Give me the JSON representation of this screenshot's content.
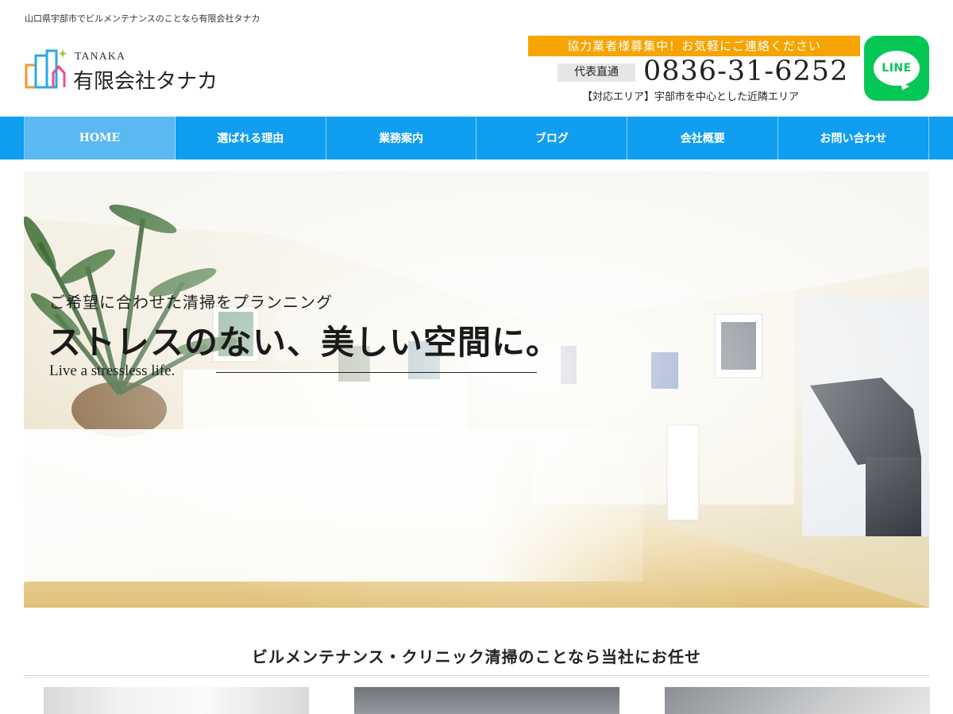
{
  "header": {
    "tagline": "山口県宇部市でビルメンテナンスのことなら有限会社タナカ",
    "logo": {
      "en": "TANAKA",
      "jp": "有限会社タナカ",
      "icon": "building-logo-icon"
    },
    "recruit_banner": "協力業者様募集中！お気軽にご連絡ください",
    "phone_label": "代表直通",
    "phone_number": "0836-31-6252",
    "service_area": "【対応エリア】宇部市を中心とした近隣エリア",
    "line_button": {
      "label": "LINE",
      "icon": "line-icon",
      "color": "#06c755"
    }
  },
  "nav": {
    "items": [
      {
        "label": "HOME",
        "active": true
      },
      {
        "label": "選ばれる理由"
      },
      {
        "label": "業務案内"
      },
      {
        "label": "ブログ"
      },
      {
        "label": "会社概要"
      },
      {
        "label": "お問い合わせ"
      }
    ],
    "color": "#0f9ef0"
  },
  "hero": {
    "sub": "ご希望に合わせた清掃をプランニング",
    "main": "ストレスのない、美しい空間に。",
    "en": "Live a stressless life."
  },
  "section": {
    "title": "ビルメンテナンス・クリニック清掃のことなら当社にお任せ"
  },
  "colors": {
    "accent_orange": "#f5a400",
    "nav_blue": "#0f9ef0",
    "nav_active": "#5ab9f0"
  }
}
